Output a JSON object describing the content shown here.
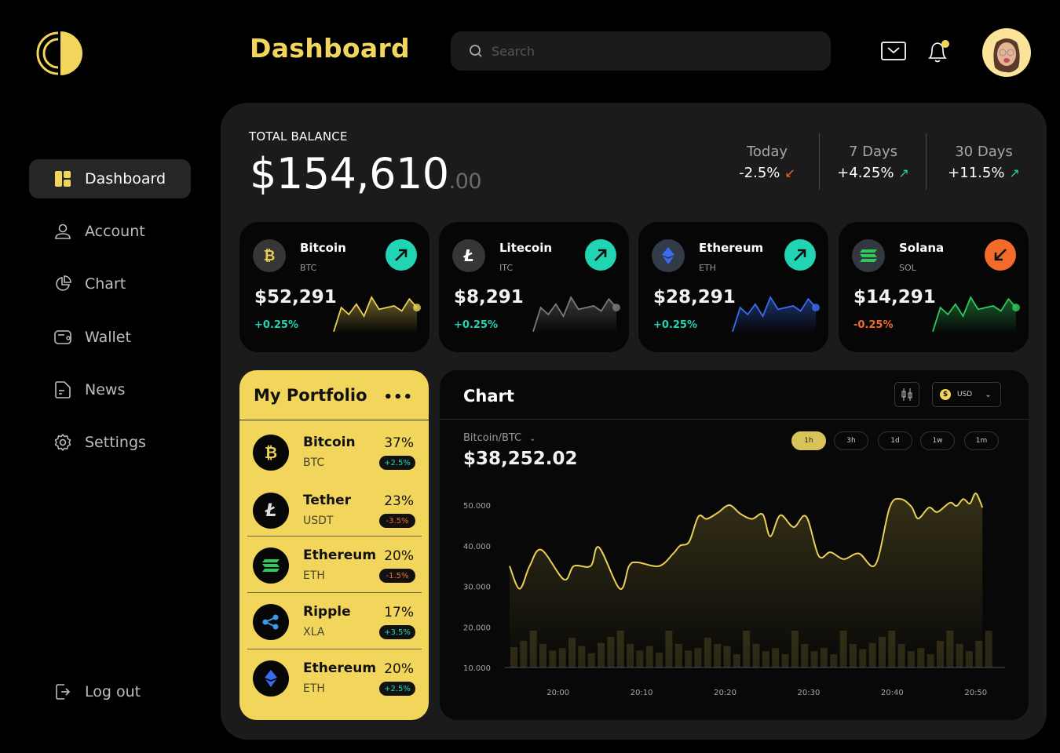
{
  "header": {
    "title": "Dashboard",
    "search_placeholder": "Search",
    "notification_dot_color": "#f2d65c"
  },
  "sidebar": {
    "items": [
      {
        "label": "Dashboard",
        "icon": "dashboard-icon",
        "active": true
      },
      {
        "label": "Account",
        "icon": "user-icon"
      },
      {
        "label": "Chart",
        "icon": "pie-chart-icon"
      },
      {
        "label": "Wallet",
        "icon": "wallet-icon"
      },
      {
        "label": "News",
        "icon": "news-icon"
      },
      {
        "label": "Settings",
        "icon": "gear-icon"
      }
    ],
    "logout_label": "Log out"
  },
  "balance": {
    "label": "TOTAL BALANCE",
    "whole": "$154,610",
    "cents": ".00",
    "stats": [
      {
        "label": "Today",
        "value": "-2.5%",
        "direction": "down",
        "color": "#f26b2a"
      },
      {
        "label": "7 Days",
        "value": "+4.25%",
        "direction": "up",
        "color": "#21d4b4"
      },
      {
        "label": "30 Days",
        "value": "+11.5%",
        "direction": "up",
        "color": "#21d4b4"
      }
    ]
  },
  "coins": [
    {
      "name": "Bitcoin",
      "symbol": "BTC",
      "price": "$52,291",
      "change": "+0.25%",
      "trend": "up",
      "color": "#e9cf55",
      "sparkline": [
        2,
        30,
        22,
        34,
        20,
        42,
        28,
        30,
        32,
        26,
        40,
        30
      ]
    },
    {
      "name": "Litecoin",
      "symbol": "ITC",
      "price": "$8,291",
      "change": "+0.25%",
      "trend": "up",
      "color": "#7a7a7a",
      "sparkline": [
        2,
        30,
        22,
        34,
        20,
        42,
        28,
        30,
        32,
        26,
        40,
        30
      ]
    },
    {
      "name": "Ethereum",
      "symbol": "ETH",
      "price": "$28,291",
      "change": "+0.25%",
      "trend": "up",
      "color": "#3a6cf0",
      "sparkline": [
        2,
        30,
        22,
        34,
        20,
        42,
        28,
        30,
        32,
        26,
        40,
        30
      ]
    },
    {
      "name": "Solana",
      "symbol": "SOL",
      "price": "$14,291",
      "change": "-0.25%",
      "trend": "down",
      "color": "#2fc95a",
      "sparkline": [
        2,
        30,
        22,
        34,
        20,
        42,
        28,
        30,
        32,
        26,
        40,
        30
      ]
    }
  ],
  "portfolio": {
    "title": "My Portfolio",
    "more_label": "•••",
    "items": [
      {
        "name": "Bitcoin",
        "symbol": "BTC",
        "percent": "37%",
        "change": "+2.5%",
        "trend": "up",
        "icon": "bitcoin-icon"
      },
      {
        "name": "Tether",
        "symbol": "USDT",
        "percent": "23%",
        "change": "-3.5%",
        "trend": "down",
        "icon": "litecoin-icon"
      },
      {
        "name": "Ethereum",
        "symbol": "ETH",
        "percent": "20%",
        "change": "-1.5%",
        "trend": "down",
        "icon": "solana-icon"
      },
      {
        "name": "Ripple",
        "symbol": "XLA",
        "percent": "17%",
        "change": "+3.5%",
        "trend": "up",
        "icon": "ripple-icon"
      },
      {
        "name": "Ethereum",
        "symbol": "ETH",
        "percent": "20%",
        "change": "+2.5%",
        "trend": "up",
        "icon": "ethereum-icon"
      }
    ]
  },
  "chart_panel": {
    "title": "Chart",
    "currency": "USD",
    "pair": "Bitcoin/BTC",
    "price": "$38,252.02",
    "timeframes": [
      "1h",
      "3h",
      "1d",
      "1w",
      "1m"
    ],
    "active_timeframe": "1h"
  },
  "chart_data": {
    "type": "area",
    "title": "",
    "xlabel": "",
    "ylabel": "",
    "x_tick_labels": [
      "20:00",
      "20:10",
      "20:20",
      "20:30",
      "20:40",
      "20:50"
    ],
    "y_tick_labels": [
      "50.000",
      "40.000",
      "30.000",
      "20.000",
      "10.000"
    ],
    "y_ticks": [
      50000,
      40000,
      30000,
      20000,
      10000
    ],
    "ylim": [
      10000,
      50000
    ],
    "xlim_minutes": [
      -5.8,
      53.5
    ],
    "grid": false,
    "color": "#e9cf55",
    "series": [
      {
        "name": "Price",
        "x_minutes": [
          -5.8,
          -4.6,
          -3.4,
          -2.0,
          0.7,
          1.9,
          3.9,
          4.9,
          7.4,
          8.5,
          9.5,
          12.1,
          13.8,
          14.6,
          15.7,
          16.8,
          17.8,
          19.1,
          20.5,
          21.8,
          23.2,
          24.5,
          25.4,
          26.6,
          28.2,
          29.7,
          31.2,
          32.6,
          34.2,
          36.0,
          38.0,
          39.7,
          41.0,
          42.3,
          43.1,
          44.4,
          45.4,
          46.9,
          47.7,
          48.5,
          49.3,
          50.0,
          50.8
        ],
        "values": [
          35000,
          29400,
          35000,
          39000,
          31700,
          35000,
          35000,
          39600,
          29400,
          35000,
          35900,
          35000,
          38100,
          40000,
          41000,
          47200,
          46600,
          48100,
          50000,
          47900,
          46600,
          47700,
          42300,
          47500,
          44600,
          47200,
          37500,
          38400,
          36700,
          38100,
          35400,
          49500,
          51500,
          49600,
          46700,
          49400,
          48300,
          50600,
          49800,
          51500,
          50400,
          52900,
          49400
        ]
      },
      {
        "name": "Volume",
        "bar_values": [
          4,
          5.2,
          7.2,
          4.6,
          3.3,
          3.8,
          5.8,
          4.2,
          2.8,
          4.8,
          6,
          7.2,
          4.6,
          3.3,
          4.2,
          2.9,
          7.2,
          4.6,
          3.3,
          3.8,
          5.8,
          4.6,
          4.2,
          2.6,
          7.2,
          4.6,
          3.2,
          3.8,
          2.6,
          7.2,
          4.6,
          3.2,
          3.8,
          2.6,
          7.2,
          4.6,
          3.6,
          4.8,
          6,
          7.2,
          4.6,
          3.2,
          3.8,
          2.6,
          5.2,
          7.2,
          4.6,
          3.2,
          5.2,
          7.2
        ]
      }
    ]
  }
}
